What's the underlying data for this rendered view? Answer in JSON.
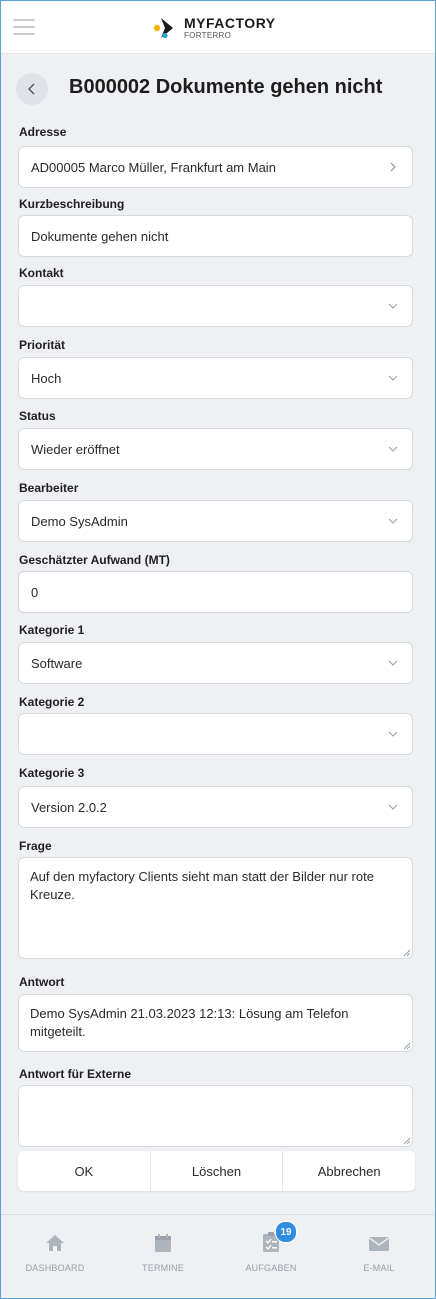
{
  "brand": {
    "name": "MYFACTORY",
    "sub": "FORTERRO"
  },
  "page": {
    "title": "B000002 Dokumente gehen nicht"
  },
  "form": {
    "adresse": {
      "label": "Adresse",
      "value": "AD00005 Marco Müller, Frankfurt am Main"
    },
    "kurzbeschreibung": {
      "label": "Kurzbeschreibung",
      "value": "Dokumente gehen nicht"
    },
    "kontakt": {
      "label": "Kontakt",
      "value": ""
    },
    "prioritaet": {
      "label": "Priorität",
      "value": "Hoch"
    },
    "status": {
      "label": "Status",
      "value": "Wieder eröffnet"
    },
    "bearbeiter": {
      "label": "Bearbeiter",
      "value": "Demo SysAdmin"
    },
    "aufwand": {
      "label": "Geschätzter Aufwand (MT)",
      "value": "0"
    },
    "kategorie1": {
      "label": "Kategorie 1",
      "value": "Software"
    },
    "kategorie2": {
      "label": "Kategorie 2",
      "value": ""
    },
    "kategorie3": {
      "label": "Kategorie 3",
      "value": "Version 2.0.2"
    },
    "frage": {
      "label": "Frage",
      "value": "Auf den myfactory Clients sieht man statt der Bilder nur rote Kreuze."
    },
    "antwort": {
      "label": "Antwort",
      "value": "Demo SysAdmin 21.03.2023 12:13:  Lösung am Telefon mitgeteilt."
    },
    "antwort_extern": {
      "label": "Antwort für Externe",
      "value": ""
    }
  },
  "actions": {
    "ok": "OK",
    "delete": "Löschen",
    "cancel": "Abbrechen"
  },
  "nav": {
    "items": [
      {
        "label": "DASHBOARD",
        "icon": "home-icon"
      },
      {
        "label": "TERMINE",
        "icon": "calendar-icon"
      },
      {
        "label": "AUFGABEN",
        "icon": "tasks-icon",
        "badge": "19"
      },
      {
        "label": "E-MAIL",
        "icon": "mail-icon"
      }
    ]
  },
  "colors": {
    "accent": "#2f8cde",
    "frame": "#5aa3d9",
    "background": "#eef0f3"
  }
}
